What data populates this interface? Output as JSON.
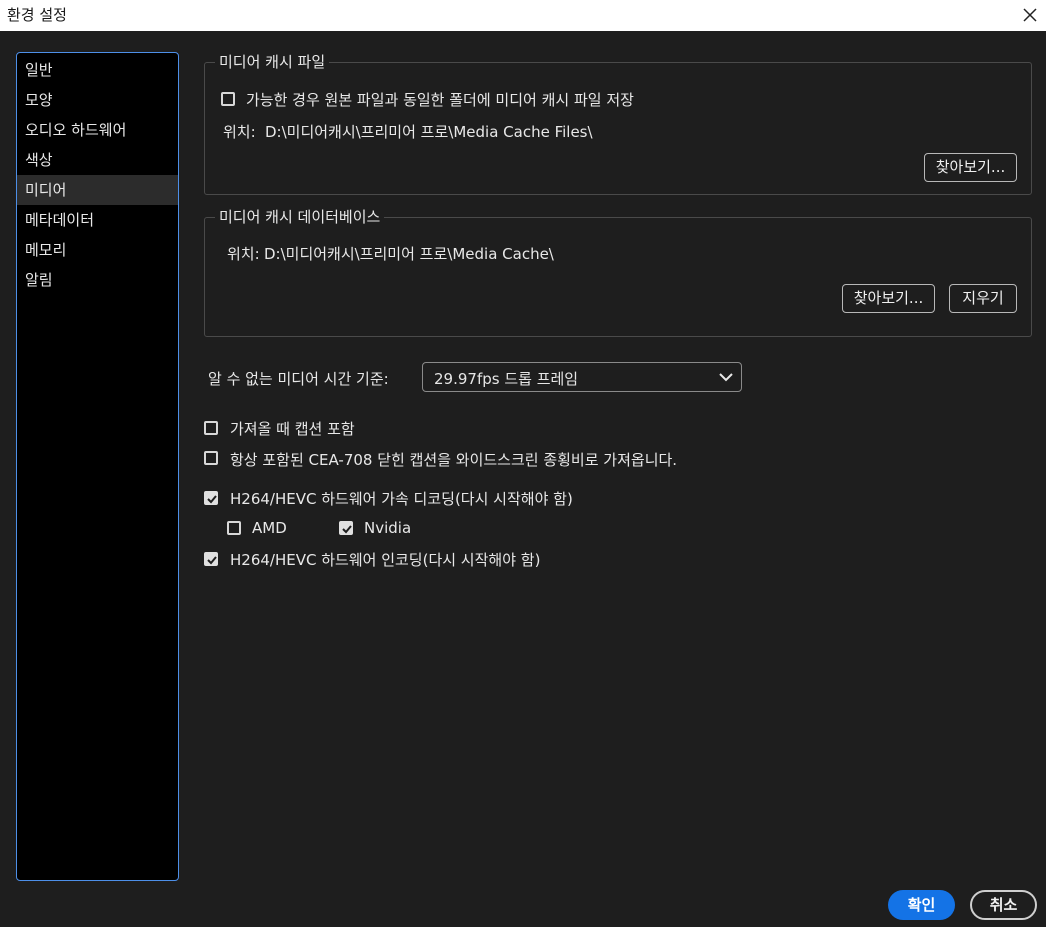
{
  "window": {
    "title": "환경 설정"
  },
  "sidebar": {
    "items": [
      {
        "label": "일반"
      },
      {
        "label": "모양"
      },
      {
        "label": "오디오 하드웨어"
      },
      {
        "label": "색상"
      },
      {
        "label": "미디어",
        "selected": true
      },
      {
        "label": "메타데이터"
      },
      {
        "label": "메모리"
      },
      {
        "label": "알림"
      }
    ]
  },
  "media_cache_files": {
    "legend": "미디어 캐시 파일",
    "checkbox_label": "가능한 경우 원본 파일과 동일한 폴더에 미디어 캐시 파일 저장",
    "checkbox_checked": false,
    "location_label": "위치:",
    "location_path": "D:\\미디어캐시\\프리미어 프로\\Media Cache Files\\",
    "browse_label": "찾아보기..."
  },
  "media_cache_db": {
    "legend": "미디어 캐시 데이터베이스",
    "location_label": "위치:",
    "location_path": "D:\\미디어캐시\\프리미어 프로\\Media Cache\\",
    "browse_label": "찾아보기...",
    "clean_label": "지우기"
  },
  "timebase": {
    "label": "알 수 없는 미디어 시간 기준:",
    "value": "29.97fps 드롭 프레임"
  },
  "options": {
    "captions_import": {
      "label": "가져올 때 캡션 포함",
      "checked": false
    },
    "cea708": {
      "label": "항상 포함된 CEA-708 닫힌 캡션을 와이드스크린 종횡비로 가져옵니다.",
      "checked": false
    },
    "hw_decode": {
      "label": "H264/HEVC 하드웨어 가속 디코딩(다시 시작해야 함)",
      "checked": true
    },
    "amd": {
      "label": "AMD",
      "checked": false
    },
    "nvidia": {
      "label": "Nvidia",
      "checked": true
    },
    "hw_encode": {
      "label": "H264/HEVC 하드웨어 인코딩(다시 시작해야 함)",
      "checked": true
    }
  },
  "footer": {
    "ok_label": "확인",
    "cancel_label": "취소"
  },
  "colors": {
    "accent": "#1473e6",
    "sidebar_border": "#4d8fe8",
    "background": "#1e1e1e"
  }
}
